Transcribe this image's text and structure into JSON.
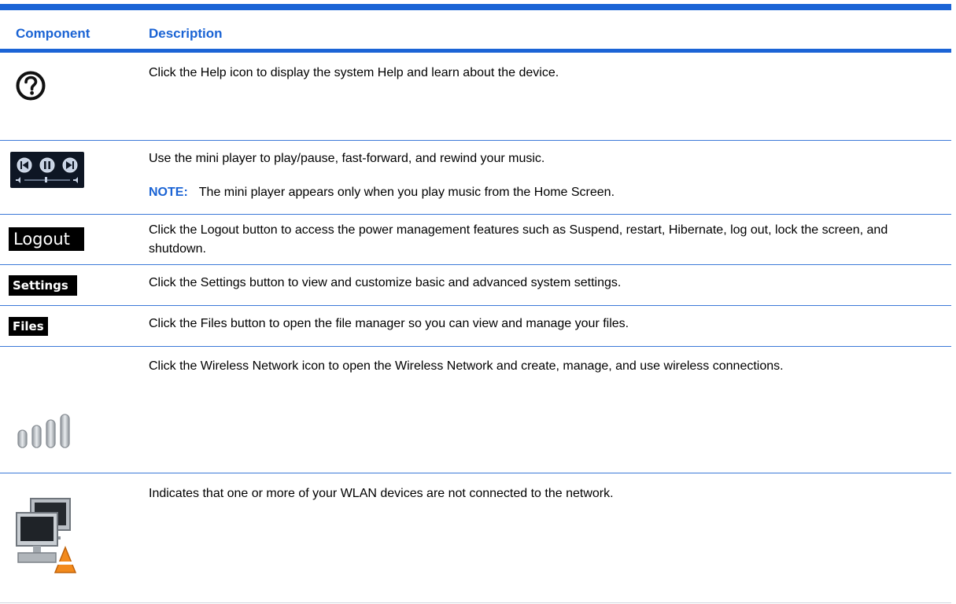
{
  "table": {
    "header": {
      "component": "Component",
      "description": "Description"
    },
    "rows": [
      {
        "icon": "help-icon",
        "description": "Click the Help icon to display the system Help and learn about the device."
      },
      {
        "icon": "mini-player-icon",
        "description": "Use the mini player to play/pause, fast-forward, and rewind your music.",
        "note_label": "NOTE:",
        "note": "The mini player appears only when you play music from the Home Screen."
      },
      {
        "icon_label": "Logout",
        "description": "Click the Logout button to access the power management features such as Suspend, restart, Hibernate, log out, lock the screen, and shutdown."
      },
      {
        "icon_label": "Settings",
        "description": "Click the Settings button to view and customize basic and advanced system settings."
      },
      {
        "icon_label": "Files",
        "description": "Click the Files button to open the file manager so you can view and manage your files."
      },
      {
        "icon": "wireless-signal-icon",
        "description": "Click the Wireless Network icon to open the Wireless Network and create, manage, and use wireless connections."
      },
      {
        "icon": "network-disconnected-warning-icon",
        "description": "Indicates that one or more of your WLAN devices are not connected to the network."
      }
    ]
  },
  "colors": {
    "accent": "#1b64d6",
    "rule": "#3c79d8"
  }
}
